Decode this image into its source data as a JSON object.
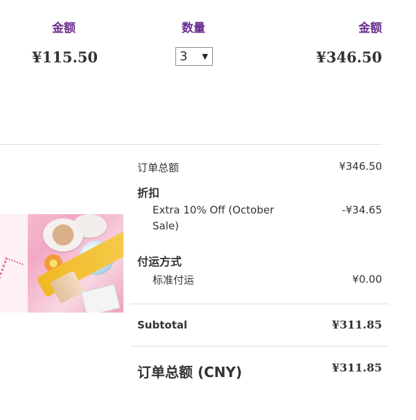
{
  "columns": {
    "price_header": "金额",
    "quantity_header": "数量",
    "amount_header": "金额"
  },
  "item": {
    "unit_price": "¥115.50",
    "quantity": "3",
    "line_total": "¥346.50"
  },
  "summary": {
    "order_total_label": "订单总额",
    "order_total_value": "¥346.50",
    "discount_heading": "折扣",
    "discount_name": "Extra 10% Off (October Sale)",
    "discount_value": "-¥34.65",
    "shipping_heading": "付运方式",
    "shipping_name": "标准付运",
    "shipping_value": "¥0.00",
    "subtotal_label": "Subtotal",
    "subtotal_value": "¥311.85",
    "grand_total_label": "订单总额 (CNY)",
    "grand_total_value": "¥311.85"
  },
  "colors": {
    "header_purple": "#6b2e8f",
    "text": "#333333",
    "divider": "#dddddd"
  },
  "icons": {
    "quantity_dropdown": "chevron-down-icon"
  }
}
